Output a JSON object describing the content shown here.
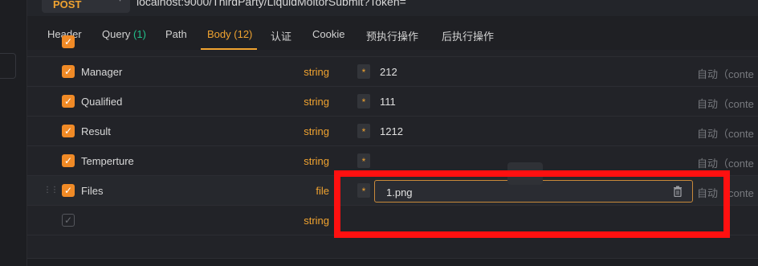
{
  "request": {
    "method": "POST",
    "url": "localhost:9000/ThirdParty/LiquidMoitorSubmit?Token="
  },
  "tabs": [
    {
      "label": "Header"
    },
    {
      "label": "Query",
      "count": "(1)"
    },
    {
      "label": "Path"
    },
    {
      "label": "Body",
      "count": "(12)",
      "active": true
    },
    {
      "label": "认证"
    },
    {
      "label": "Cookie"
    },
    {
      "label": "预执行操作"
    },
    {
      "label": "后执行操作"
    }
  ],
  "rows": [
    {
      "name": "Manager",
      "type": "string",
      "required": "*",
      "value": "212",
      "content_type": "自动（conte"
    },
    {
      "name": "Qualified",
      "type": "string",
      "required": "*",
      "value": "111",
      "content_type": "自动（conte"
    },
    {
      "name": "Result",
      "type": "string",
      "required": "*",
      "value": "1212",
      "content_type": "自动（conte"
    },
    {
      "name": "Temperture",
      "type": "string",
      "required": "*",
      "value": "",
      "content_type": "自动（conte"
    },
    {
      "name": "Files",
      "type": "file",
      "required": "*",
      "file_value": "1.png",
      "content_type": "自动（conte"
    },
    {
      "name": "",
      "type": "string",
      "required": "",
      "value": "",
      "content_type": ""
    }
  ],
  "icons": {
    "checkbox": "check-icon",
    "delete": "trash-icon",
    "drag": "drag-handle-icon",
    "method_dropdown": "chevron-down-icon"
  },
  "colors": {
    "accent": "#f0a330",
    "checkbox": "#f08a26",
    "count_green": "#22c08a",
    "annotation": "#ff1010"
  }
}
